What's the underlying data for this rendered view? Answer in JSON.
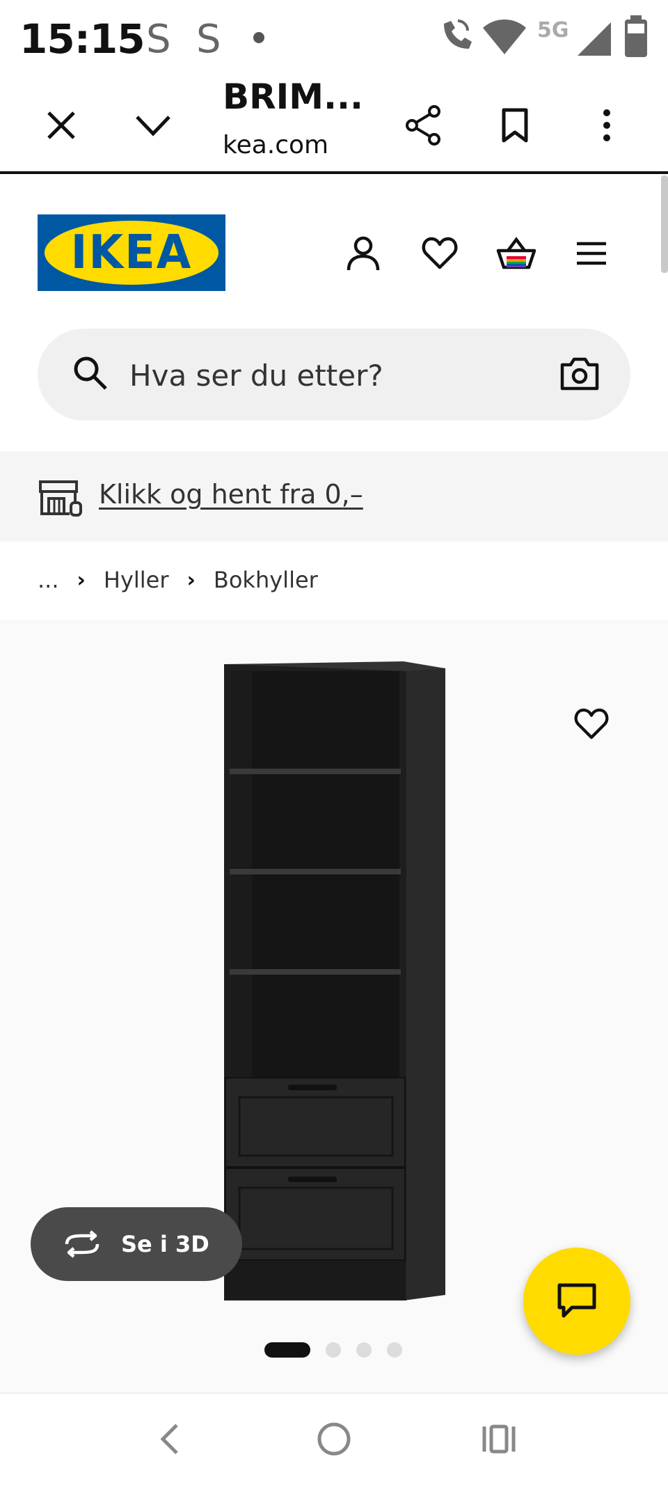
{
  "status_bar": {
    "time": "15:15",
    "indicators": [
      "S",
      "S"
    ],
    "network": "5G",
    "icons": [
      "wifi-calling-icon",
      "wifi-icon",
      "signal-icon",
      "battery-icon"
    ]
  },
  "browser": {
    "title": "BRIM...",
    "url": "kea.com",
    "buttons": [
      "close-icon",
      "chevron-down-icon",
      "share-icon",
      "bookmark-icon",
      "more-vertical-icon"
    ]
  },
  "header": {
    "logo_text": "IKEA",
    "icons": [
      "profile-icon",
      "heart-icon",
      "basket-icon",
      "menu-icon"
    ]
  },
  "search": {
    "placeholder": "Hva ser du etter?"
  },
  "promo": {
    "text": "Klikk og hent fra 0,–"
  },
  "breadcrumb": {
    "items": [
      "...",
      "Hyller",
      "Bokhyller"
    ]
  },
  "product_media": {
    "view_3d_label": "Se i 3D",
    "carousel": {
      "total": 4,
      "active": 1
    }
  },
  "colors": {
    "ikea_blue": "#0058a3",
    "ikea_yellow": "#ffdb00",
    "pill_gray": "#4a4a4a"
  }
}
